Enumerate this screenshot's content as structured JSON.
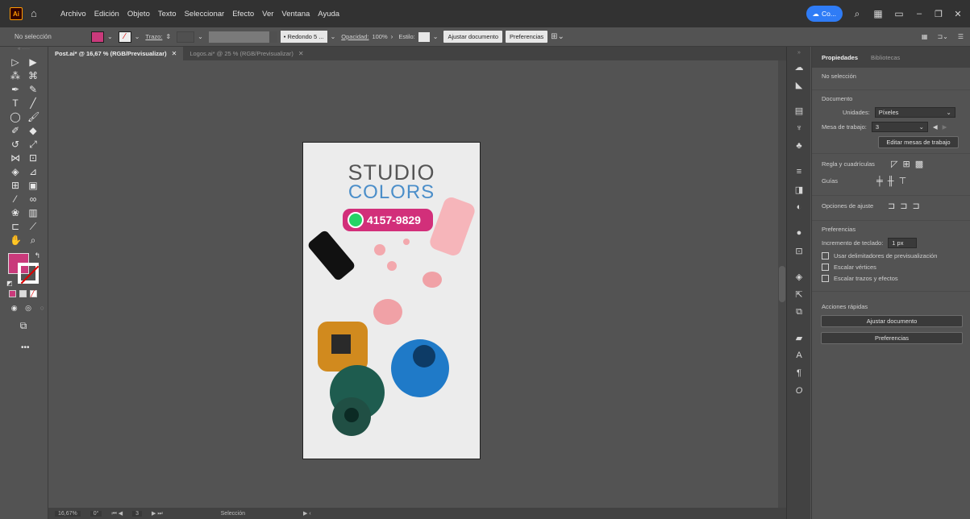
{
  "menubar": {
    "logo_text": "Ai",
    "items": [
      "Archivo",
      "Edición",
      "Objeto",
      "Texto",
      "Seleccionar",
      "Efecto",
      "Ver",
      "Ventana",
      "Ayuda"
    ],
    "cloud_label": "Co..."
  },
  "controlbar": {
    "selection_label": "No selección",
    "fill_color": "#c93a7b",
    "stroke_label": "Trazo:",
    "brush_label": "Redondo 5 ...",
    "opacity_label": "Opacidad:",
    "opacity_value": "100%",
    "style_label": "Estilo:",
    "fit_button": "Ajustar documento",
    "prefs_button": "Preferencias"
  },
  "tabs": [
    {
      "label": "Post.ai* @ 16,67 % (RGB/Previsualizar)",
      "active": true
    },
    {
      "label": "Logos.ai* @ 25 % (RGB/Previsualizar)",
      "active": false
    }
  ],
  "artboard": {
    "brand_line1": "STUDIO",
    "brand_line2": "COLORS",
    "phone": "4157-9829"
  },
  "status": {
    "zoom": "16,67%",
    "rotation": "0°",
    "artboard_index": "3",
    "tool": "Selección"
  },
  "panel": {
    "tab_properties": "Propiedades",
    "tab_libraries": "Bibliotecas",
    "no_selection": "No selección",
    "document_title": "Documento",
    "units_label": "Unidades:",
    "units_value": "Píxeles",
    "artboard_label": "Mesa de trabajo:",
    "artboard_value": "3",
    "edit_artboards_button": "Editar mesas de trabajo",
    "rulers_label": "Regla y cuadrículas",
    "guides_label": "Guías",
    "snap_label": "Opciones de ajuste",
    "prefs_title": "Preferencias",
    "keyboard_inc_label": "Incremento de teclado:",
    "keyboard_inc_value": "1 px",
    "check_preview_bounds": "Usar delimitadores de previsualización",
    "check_scale_corners": "Escalar vértices",
    "check_scale_strokes": "Escalar trazos y efectos",
    "quick_actions_title": "Acciones rápidas",
    "quick_fit_button": "Ajustar documento",
    "quick_prefs_button": "Preferencias"
  }
}
